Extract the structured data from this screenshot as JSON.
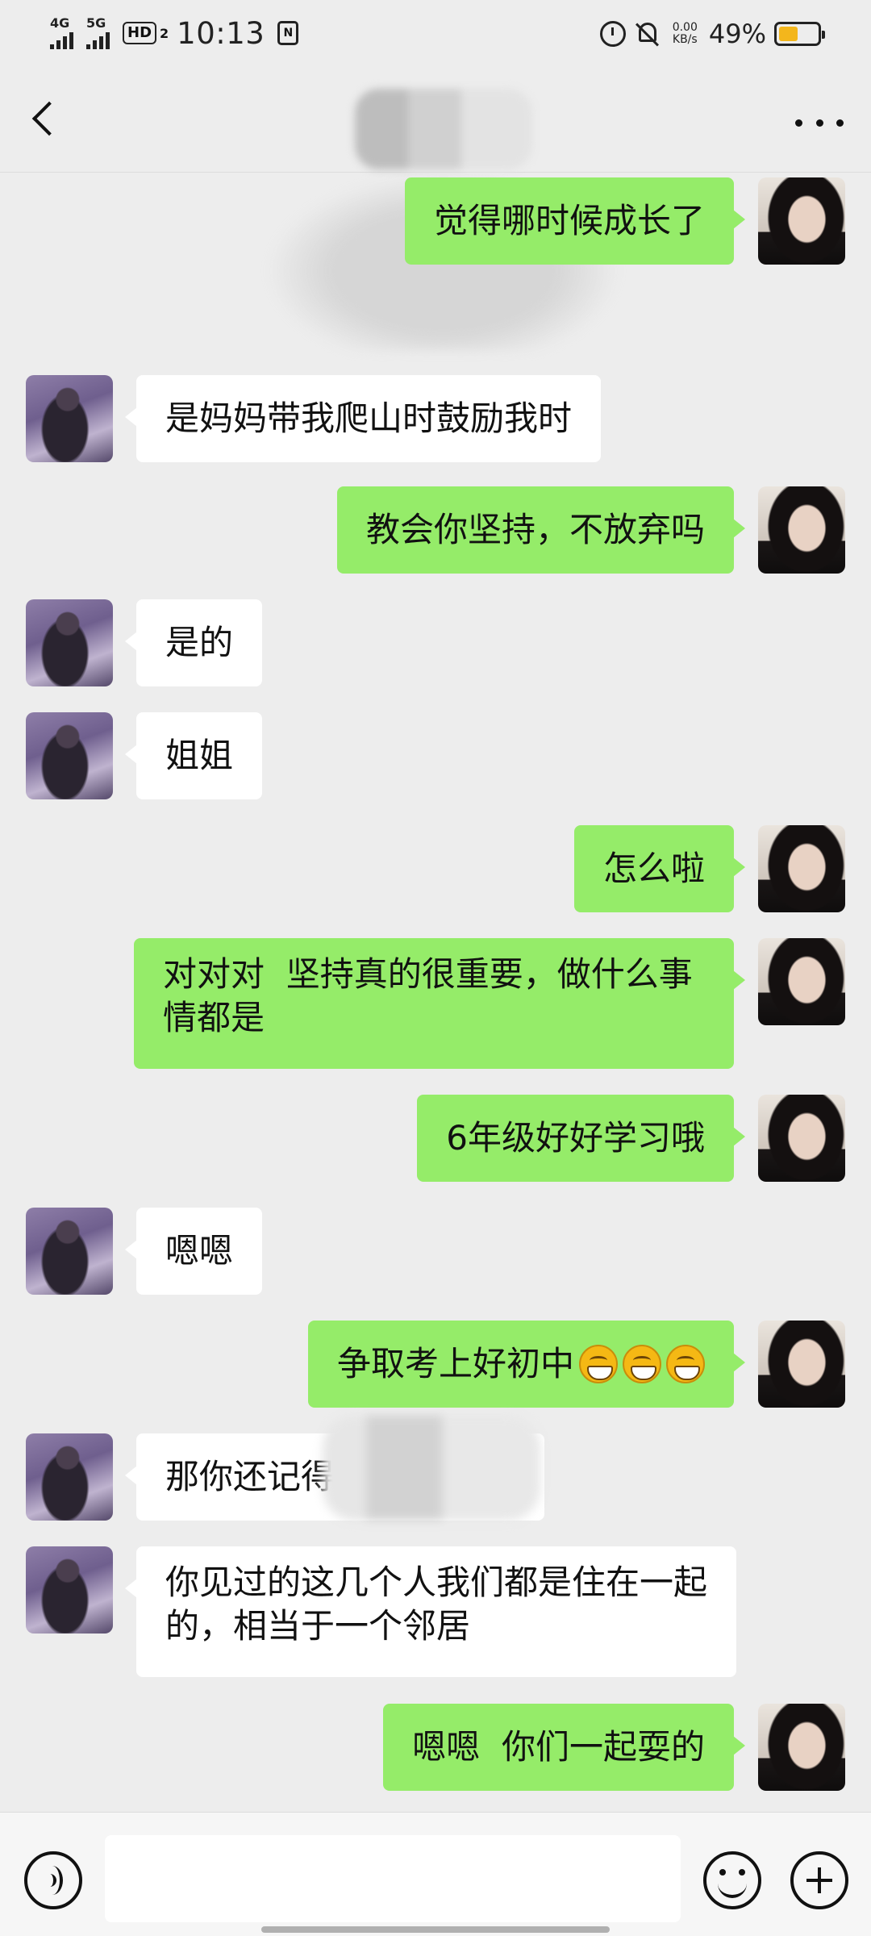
{
  "status_bar": {
    "net1": "4G",
    "net2": "5G",
    "hd": "HD",
    "hd_sub": "2",
    "time": "10:13",
    "nfc": "N",
    "speed_value": "0.00",
    "speed_unit": "KB/s",
    "battery_percent": "49%",
    "battery_level": 0.49,
    "battery_color": "#f3b61c"
  },
  "header": {
    "back_icon": "chevron-left-icon",
    "title": "",
    "more_icon": "more-dots-icon"
  },
  "colors": {
    "me_bubble": "#95ec69",
    "them_bubble": "#ffffff",
    "background": "#ededed"
  },
  "messages": [
    {
      "sender": "me",
      "text": "觉得哪时候成长了"
    },
    {
      "sender": "them",
      "text": "是妈妈带我爬山时鼓励我时"
    },
    {
      "sender": "me",
      "text": "教会你坚持，不放弃吗"
    },
    {
      "sender": "them",
      "text": "是的"
    },
    {
      "sender": "them",
      "text": "姐姐"
    },
    {
      "sender": "me",
      "text": "怎么啦"
    },
    {
      "sender": "me",
      "text": "对对对  坚持真的很重要，做什么事情都是"
    },
    {
      "sender": "me",
      "text": "6年级好好学习哦"
    },
    {
      "sender": "them",
      "text": "嗯嗯"
    },
    {
      "sender": "me",
      "text": "争取考上好初中",
      "emoji": "grin-emoji",
      "emoji_count": 3
    },
    {
      "sender": "them",
      "text": "那你还记得"
    },
    {
      "sender": "them",
      "text": "你见过的这几个人我们都是住在一起的，相当于一个邻居"
    },
    {
      "sender": "me",
      "text": "嗯嗯  你们一起耍的"
    }
  ],
  "input_bar": {
    "voice_icon": "voice-icon",
    "message_value": "",
    "emoji_icon": "emoji-icon",
    "plus_icon": "plus-icon"
  }
}
